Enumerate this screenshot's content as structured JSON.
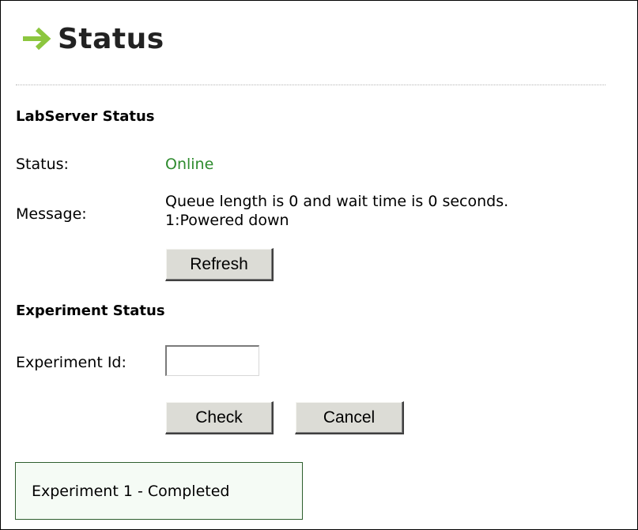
{
  "header": {
    "title": "Status",
    "icon": "right-arrow-icon",
    "accent_color": "#8cc63f"
  },
  "labserver": {
    "heading": "LabServer Status",
    "status_label": "Status:",
    "status_value": "Online",
    "status_color": "#2e8b2e",
    "message_label": "Message:",
    "message_line1": "Queue length is 0 and wait time is 0 seconds.",
    "message_line2": "1:Powered down",
    "refresh_label": "Refresh"
  },
  "experiment": {
    "heading": "Experiment Status",
    "id_label": "Experiment Id:",
    "id_value": "",
    "check_label": "Check",
    "cancel_label": "Cancel",
    "result_text": "Experiment 1 - Completed"
  }
}
